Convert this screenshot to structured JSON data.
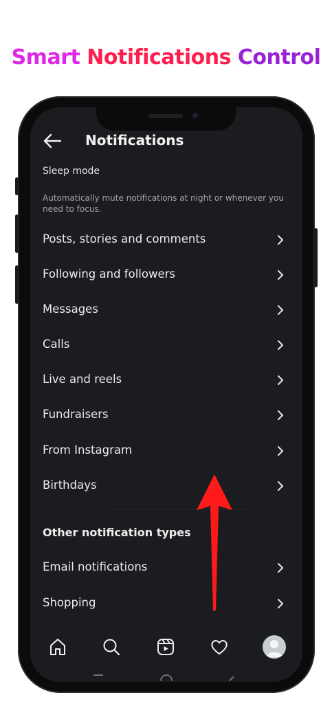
{
  "banner": {
    "word1": "Smart",
    "word2": "Notifications",
    "word3": "Control"
  },
  "header": {
    "title": "Notifications",
    "back_icon": "arrow-left-icon"
  },
  "sleep_mode": {
    "title": "Sleep mode",
    "description": "Automatically mute notifications at night or whenever you need to focus."
  },
  "settings": [
    {
      "label": "Posts, stories and comments"
    },
    {
      "label": "Following and followers"
    },
    {
      "label": "Messages"
    },
    {
      "label": "Calls"
    },
    {
      "label": "Live and reels"
    },
    {
      "label": "Fundraisers"
    },
    {
      "label": "From Instagram"
    },
    {
      "label": "Birthdays"
    }
  ],
  "other_section": {
    "title": "Other notification types",
    "items": [
      {
        "label": "Email notifications"
      },
      {
        "label": "Shopping"
      }
    ]
  },
  "bottom_nav": [
    "home-icon",
    "search-icon",
    "reels-icon",
    "heart-icon",
    "profile-avatar"
  ],
  "colors": {
    "screen_bg": "#1b1c1f",
    "annotation_arrow": "#ff1a1a",
    "headline_gradient": [
      "#e026e8",
      "#ff1f4e",
      "#9a22d8"
    ]
  }
}
